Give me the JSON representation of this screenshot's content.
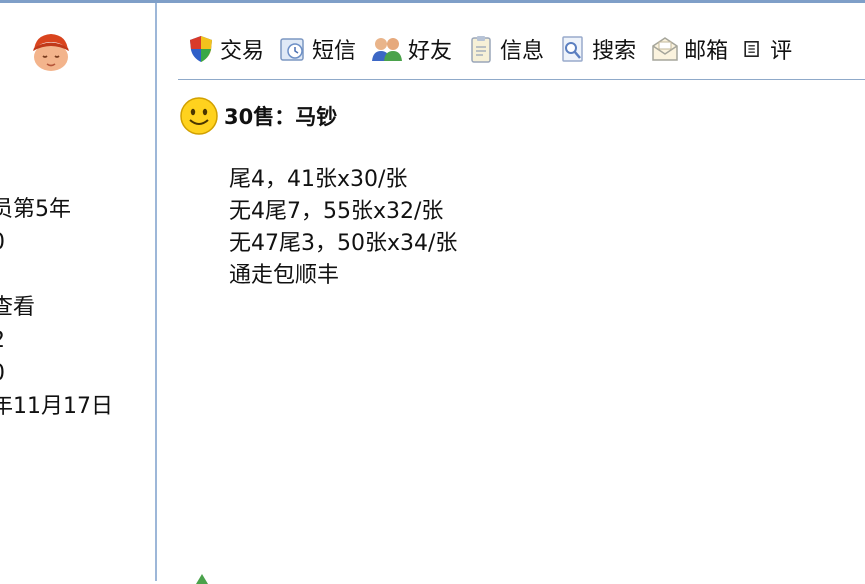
{
  "profile": {
    "lines": [
      "员第5年",
      "0",
      "查看",
      "2",
      "0",
      "年11月17日"
    ]
  },
  "toolbar": {
    "items": [
      {
        "label": "交易",
        "icon": "shield-icon"
      },
      {
        "label": "短信",
        "icon": "message-icon"
      },
      {
        "label": "好友",
        "icon": "friends-icon"
      },
      {
        "label": "信息",
        "icon": "clipboard-icon"
      },
      {
        "label": "搜索",
        "icon": "search-icon"
      },
      {
        "label": "邮箱",
        "icon": "envelope-icon"
      },
      {
        "label": "评",
        "icon": "list-icon"
      }
    ]
  },
  "post": {
    "title": "30售：马钞",
    "lines": [
      "尾4，41张x30/张",
      "无4尾7，55张x32/张",
      "无47尾3，50张x34/张",
      "通走包顺丰"
    ]
  },
  "colors": {
    "divider": "#9db7d8",
    "accent": "#7f9fc8",
    "smiley": "#ffd21e"
  }
}
